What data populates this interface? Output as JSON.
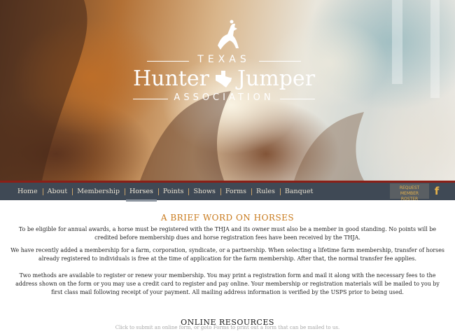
{
  "logo": {
    "line1": "TEXAS",
    "line2_left": "Hunter",
    "line2_right": "Jumper",
    "line3": "ASSOCIATION"
  },
  "nav": {
    "items": [
      {
        "label": "Home"
      },
      {
        "label": "About"
      },
      {
        "label": "Membership"
      },
      {
        "label": "Horses"
      },
      {
        "label": "Points"
      },
      {
        "label": "Shows"
      },
      {
        "label": "Forms"
      },
      {
        "label": "Rules"
      },
      {
        "label": "Banquet"
      }
    ],
    "active": "Horses",
    "request_button_line1": "REQUEST MEMBER",
    "request_button_line2": "ROSTER",
    "facebook_icon": "facebook-icon",
    "facebook_glyph": "f"
  },
  "main": {
    "heading": "A BRIEF WORD ON HORSES",
    "paragraph1": "To be eligible for annual awards, a horse must be registered with the THJA and its owner must also be a member in good standing. No points will be credited before membership dues and horse registration fees have been received by the THJA.",
    "paragraph2": "We have recently added a membership for a farm, corporation, syndicate, or a partnership. When selecting a lifetime farm membership, transfer of horses already registered to individuals is free at the time of application for the farm membership. After that, the normal transfer fee applies.",
    "paragraph3": "Two methods are available to register or renew your membership. You may print a registration form and mail it along with the necessary fees to the address shown on the form or you may use a credit card to register and pay online. Your membership or registration materials will be mailed to you by first class mail following receipt of your payment. All mailing address information is verified by the USPS prior to being used.",
    "resources_heading": "ONLINE RESOURCES",
    "resources_sub": "Click to submit an online form, or goto Forms to print out a form that can be mailed to us."
  },
  "colors": {
    "nav_bg": "#3f4955",
    "nav_top_border": "#8a1f17",
    "accent_orange": "#c8791b",
    "button_text": "#e6b24c"
  }
}
